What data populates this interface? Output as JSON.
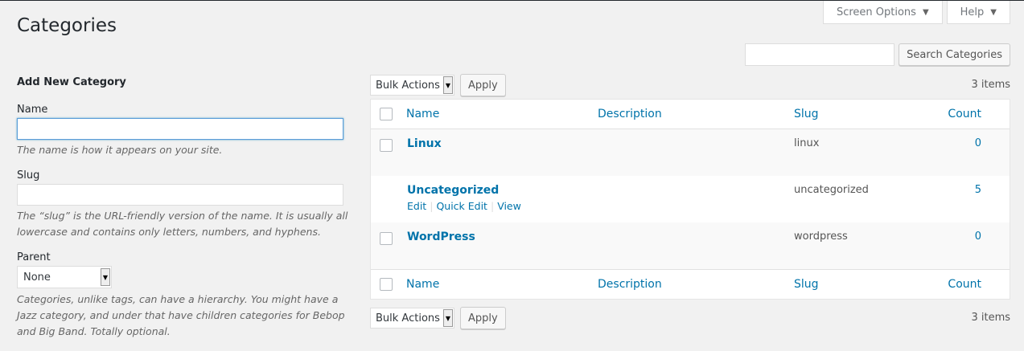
{
  "screen_meta": {
    "screen_options": "Screen Options",
    "help": "Help"
  },
  "page": {
    "title": "Categories"
  },
  "search": {
    "button": "Search Categories",
    "value": ""
  },
  "form": {
    "heading": "Add New Category",
    "name_label": "Name",
    "name_value": "",
    "name_desc": "The name is how it appears on your site.",
    "slug_label": "Slug",
    "slug_value": "",
    "slug_desc": "The “slug” is the URL-friendly version of the name. It is usually all lowercase and contains only letters, numbers, and hyphens.",
    "parent_label": "Parent",
    "parent_selected": "None",
    "parent_desc": "Categories, unlike tags, can have a hierarchy. You might have a Jazz category, and under that have children categories for Bebop and Big Band. Totally optional."
  },
  "tablenav": {
    "bulk_actions": "Bulk Actions",
    "apply": "Apply",
    "items_count": "3 items"
  },
  "table": {
    "columns": {
      "name": "Name",
      "description": "Description",
      "slug": "Slug",
      "count": "Count"
    },
    "rows": [
      {
        "name": "Linux",
        "description": "",
        "slug": "linux",
        "count": "0",
        "checkbox": true
      },
      {
        "name": "Uncategorized",
        "description": "",
        "slug": "uncategorized",
        "count": "5",
        "checkbox": false,
        "actions": {
          "edit": "Edit",
          "quick_edit": "Quick Edit",
          "view": "View"
        }
      },
      {
        "name": "WordPress",
        "description": "",
        "slug": "wordpress",
        "count": "0",
        "checkbox": true
      }
    ]
  },
  "colors": {
    "link": "#0073aa",
    "background": "#f1f1f1",
    "focus_border": "#5b9dd9"
  },
  "icons": {
    "dropdown": "caret-down-icon",
    "select_arrow": "select-arrow-icon"
  }
}
